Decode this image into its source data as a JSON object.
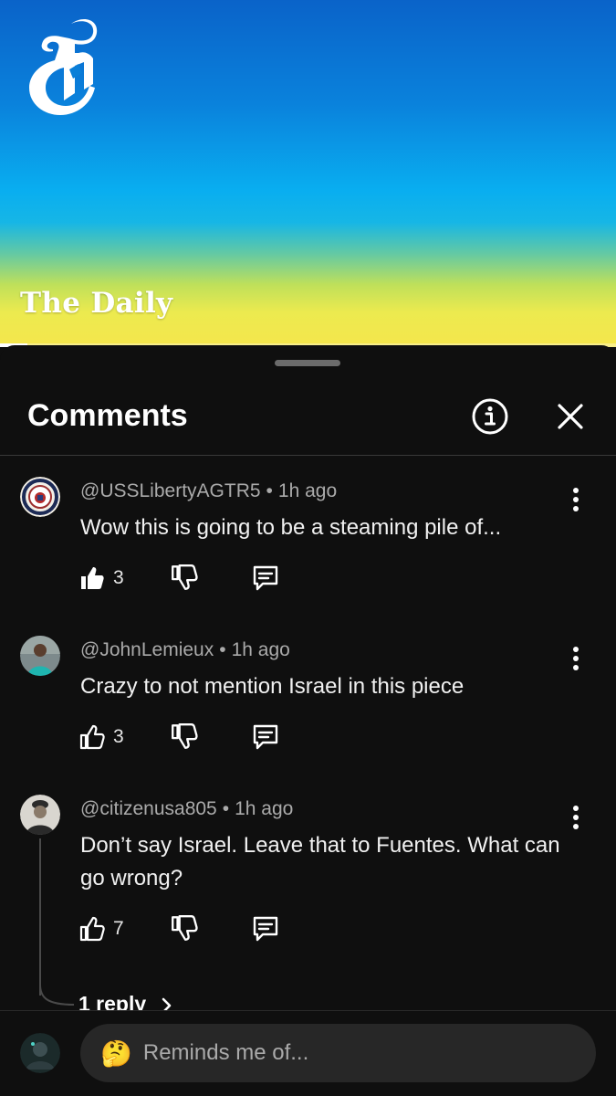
{
  "video": {
    "show_title": "The Daily",
    "progress_fraction": 0.045
  },
  "comments_sheet": {
    "title": "Comments",
    "info_icon": "info-circle-icon",
    "close_icon": "close-icon"
  },
  "comments": [
    {
      "author": "@USSLibertyAGTR5",
      "separator": "•",
      "time": "1h ago",
      "text": "Wow this is going to be a steaming pile of...",
      "likes": "3",
      "liked": true
    },
    {
      "author": "@JohnLemieux",
      "separator": "•",
      "time": "1h ago",
      "text": "Crazy to not mention Israel in this piece",
      "likes": "3",
      "liked": false
    },
    {
      "author": "@citizenusa805",
      "separator": "•",
      "time": "1h ago",
      "text": "Don’t say Israel.  Leave that to Fuentes.  What can go wrong?",
      "likes": "7",
      "liked": false,
      "replies_label": "1 reply"
    }
  ],
  "composer": {
    "emoji": "🤔",
    "placeholder": "Reminds me of..."
  },
  "colors": {
    "sheet_bg": "#0f0f0f",
    "text_primary": "#f1f1f1",
    "text_secondary": "#aaaaaa"
  }
}
